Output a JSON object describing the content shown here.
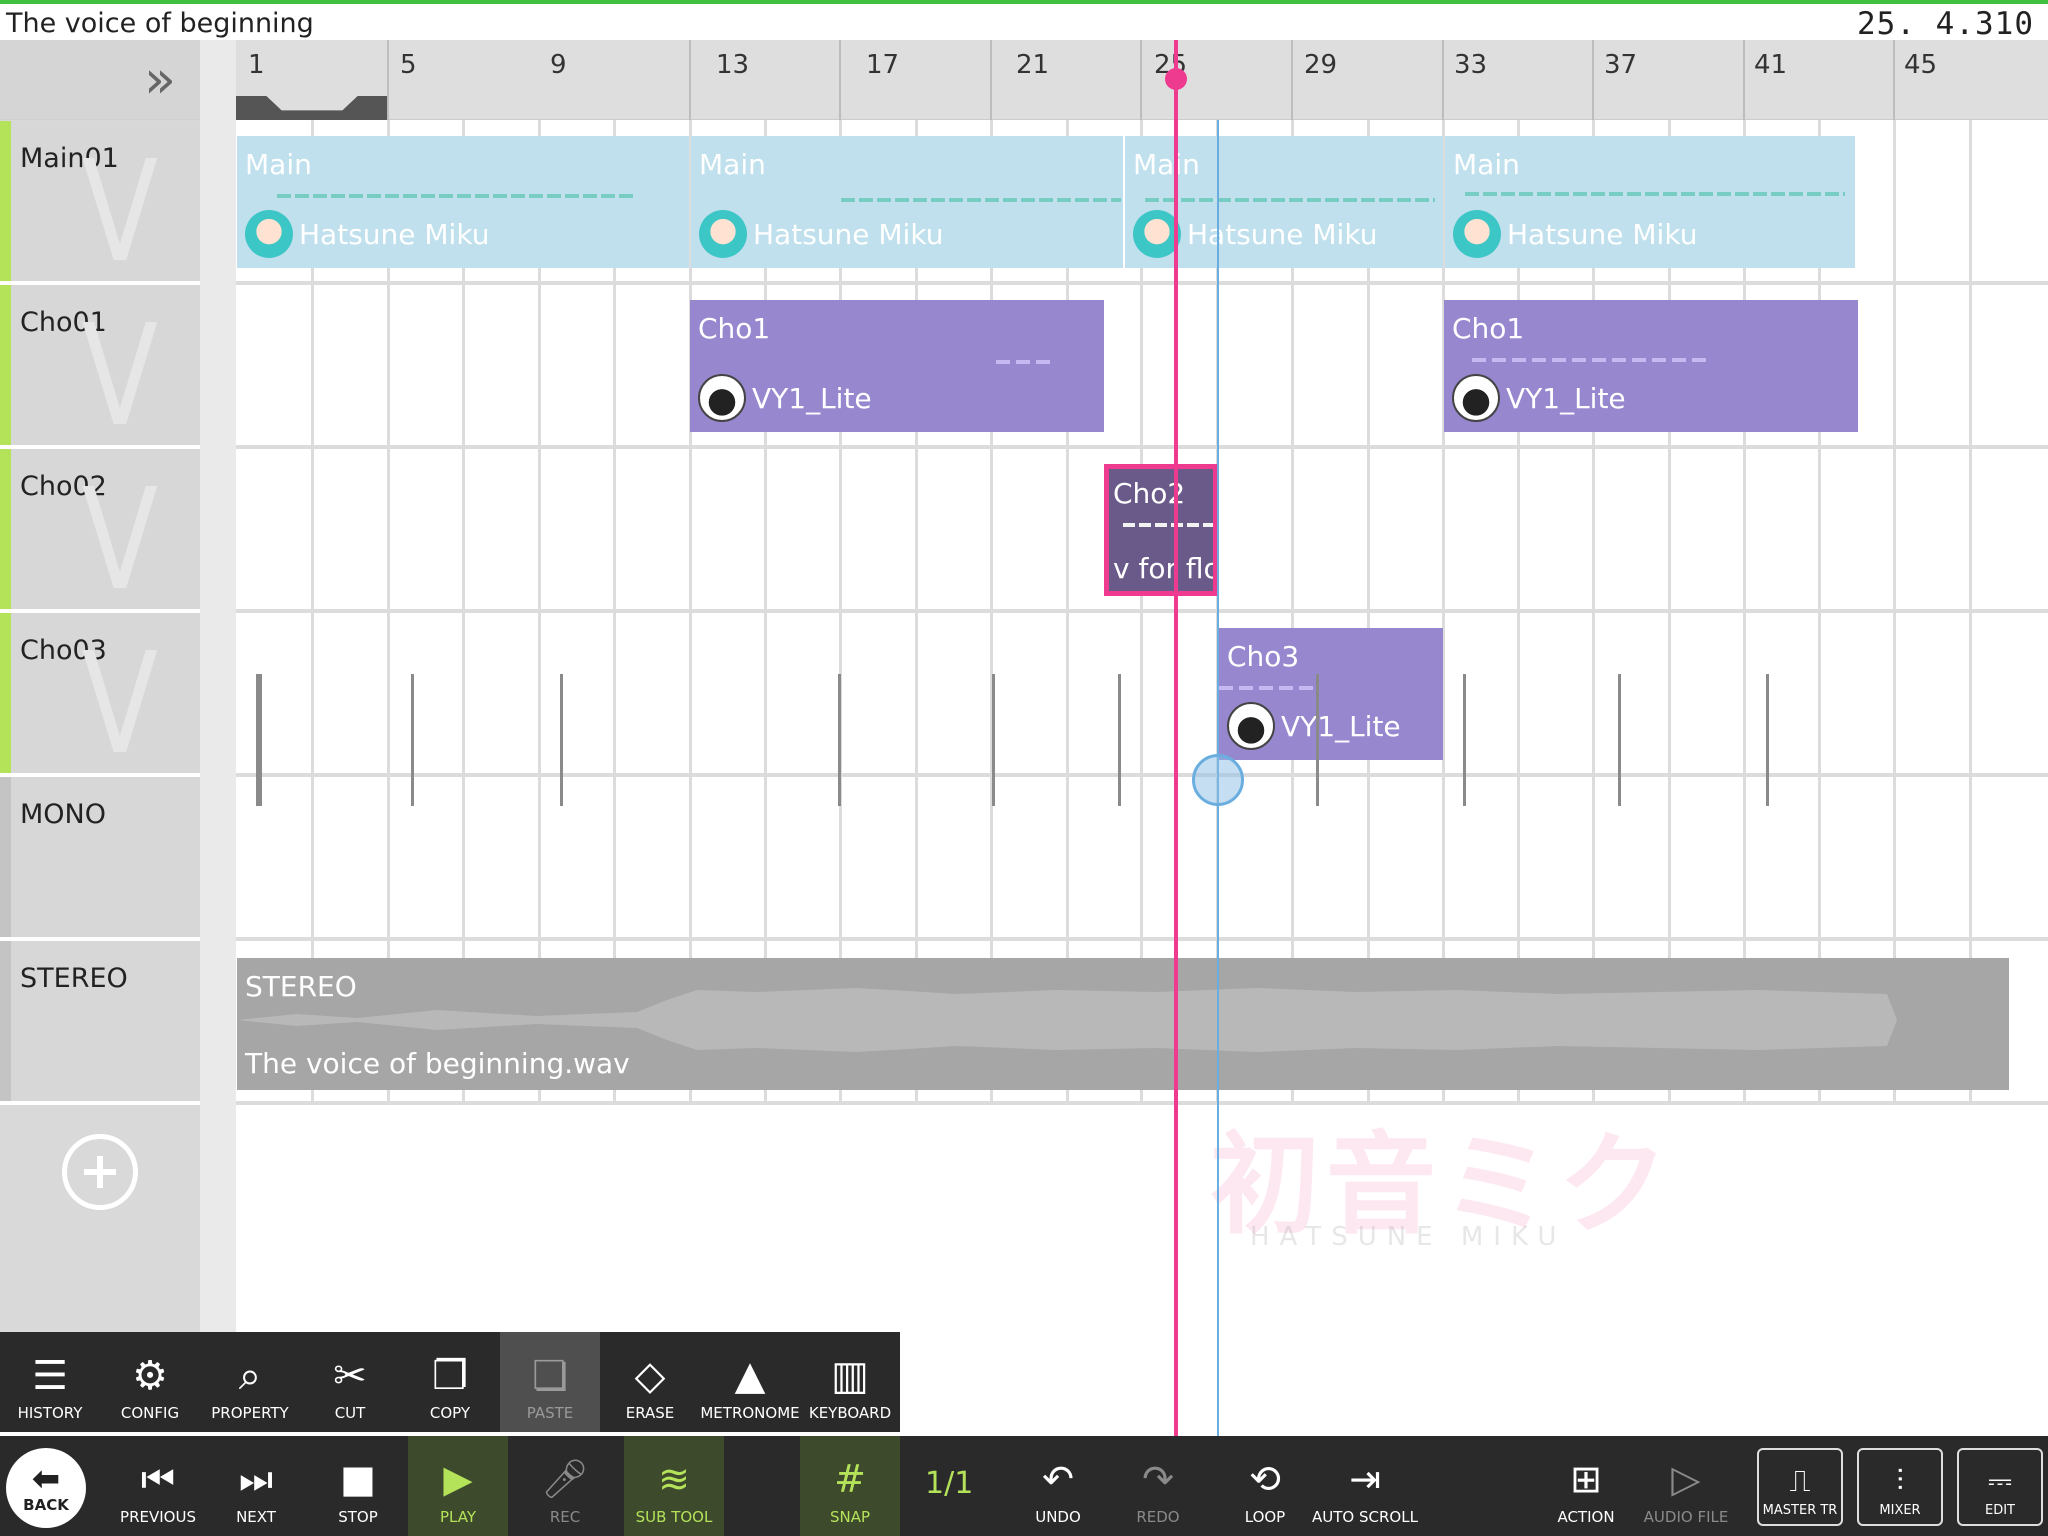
{
  "header": {
    "song_title": "The voice of beginning",
    "position": "25. 4.310"
  },
  "ruler": {
    "bars": [
      "1",
      "5",
      "9",
      "13",
      "17",
      "21",
      "25",
      "29",
      "33",
      "37",
      "41",
      "45"
    ]
  },
  "tracks": [
    {
      "name": "Main01"
    },
    {
      "name": "Cho01"
    },
    {
      "name": "Cho02"
    },
    {
      "name": "Cho03"
    },
    {
      "name": "MONO"
    },
    {
      "name": "STEREO"
    }
  ],
  "clips": {
    "main_1": {
      "title": "Main",
      "singer": "Hatsune Miku"
    },
    "main_2": {
      "title": "Main",
      "singer": "Hatsune Miku"
    },
    "main_3": {
      "title": "Main",
      "singer": "Hatsune Miku"
    },
    "main_4": {
      "title": "Main",
      "singer": "Hatsune Miku"
    },
    "cho1_1": {
      "title": "Cho1",
      "singer": "VY1_Lite"
    },
    "cho1_2": {
      "title": "Cho1",
      "singer": "VY1_Lite"
    },
    "cho2_1": {
      "title": "Cho2",
      "singer": "v for flo"
    },
    "cho3_1": {
      "title": "Cho3",
      "singer": "VY1_Lite"
    },
    "stereo_1": {
      "title": "STEREO",
      "file": "The voice of beginning.wav"
    }
  },
  "watermark": {
    "title": "初音ミク",
    "subtitle": "HATSUNE MIKU"
  },
  "subtool": {
    "history": "HISTORY",
    "config": "CONFIG",
    "property": "PROPERTY",
    "cut": "CUT",
    "copy": "COPY",
    "paste": "PASTE",
    "erase": "ERASE",
    "metronome": "METRONOME",
    "keyboard": "KEYBOARD"
  },
  "toolbar": {
    "back": "BACK",
    "previous": "PREVIOUS",
    "next": "NEXT",
    "stop": "STOP",
    "play": "PLAY",
    "rec": "REC",
    "sub_tool": "SUB TOOL",
    "snap": "SNAP",
    "snap_ratio": "1/1",
    "undo": "UNDO",
    "redo": "REDO",
    "loop": "LOOP",
    "auto_scroll": "AUTO SCROLL",
    "action": "ACTION",
    "audio_file": "AUDIO FILE",
    "master_tr": "MASTER TR",
    "mixer": "MIXER",
    "edit": "EDIT"
  },
  "colors": {
    "accent_green": "#b4e35a",
    "playhead": "#ee3b8f",
    "main_clip": "#bfe0ec",
    "cho_clip": "#9787cf"
  }
}
